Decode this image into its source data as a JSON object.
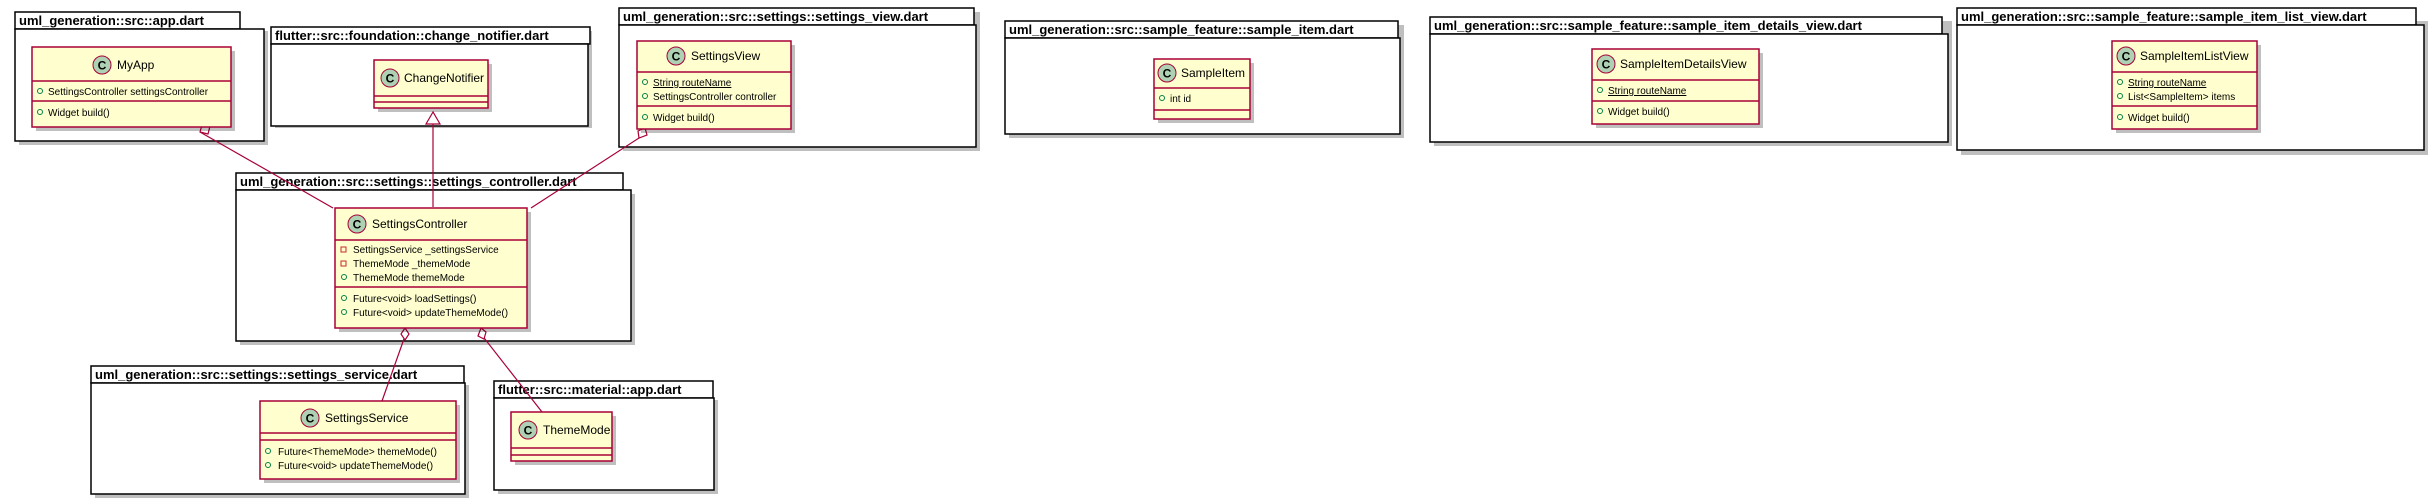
{
  "packages": {
    "app": "uml_generation::src::app.dart",
    "change_notifier": "flutter::src::foundation::change_notifier.dart",
    "settings_view": "uml_generation::src::settings::settings_view.dart",
    "sample_item": "uml_generation::src::sample_feature::sample_item.dart",
    "sample_item_details_view": "uml_generation::src::sample_feature::sample_item_details_view.dart",
    "sample_item_list_view": "uml_generation::src::sample_feature::sample_item_list_view.dart",
    "settings_controller": "uml_generation::src::settings::settings_controller.dart",
    "settings_service": "uml_generation::src::settings::settings_service.dart",
    "material_app": "flutter::src::material::app.dart"
  },
  "classes": {
    "my_app": {
      "name": "MyApp",
      "fields": [
        "SettingsController settingsController"
      ],
      "methods": [
        "Widget build()"
      ]
    },
    "change_notifier": {
      "name": "ChangeNotifier",
      "fields": [],
      "methods": []
    },
    "settings_view": {
      "name": "SettingsView",
      "fields": [
        "String routeName",
        "SettingsController controller"
      ],
      "methods": [
        "Widget build()"
      ]
    },
    "sample_item": {
      "name": "SampleItem",
      "fields": [
        "int id"
      ],
      "methods": []
    },
    "sample_item_details_view": {
      "name": "SampleItemDetailsView",
      "fields": [
        "String routeName"
      ],
      "methods": [
        "Widget build()"
      ]
    },
    "sample_item_list_view": {
      "name": "SampleItemListView",
      "fields": [
        "String routeName",
        "List<SampleItem> items"
      ],
      "methods": [
        "Widget build()"
      ]
    },
    "settings_controller": {
      "name": "SettingsController",
      "fields": [
        "SettingsService _settingsService",
        "ThemeMode _themeMode",
        "ThemeMode themeMode"
      ],
      "methods": [
        "Future<void> loadSettings()",
        "Future<void> updateThemeMode()"
      ]
    },
    "settings_service": {
      "name": "SettingsService",
      "fields": [],
      "methods": [
        "Future<ThemeMode> themeMode()",
        "Future<void> updateThemeMode()"
      ]
    },
    "theme_mode": {
      "name": "ThemeMode",
      "fields": [],
      "methods": []
    }
  },
  "class_icon_letter": "C",
  "colors": {
    "class_fill": "#FEFECE",
    "class_border": "#A80036",
    "class_icon": "#ADD1B2",
    "public_marker": "#038048",
    "private_marker": "#C82930"
  }
}
